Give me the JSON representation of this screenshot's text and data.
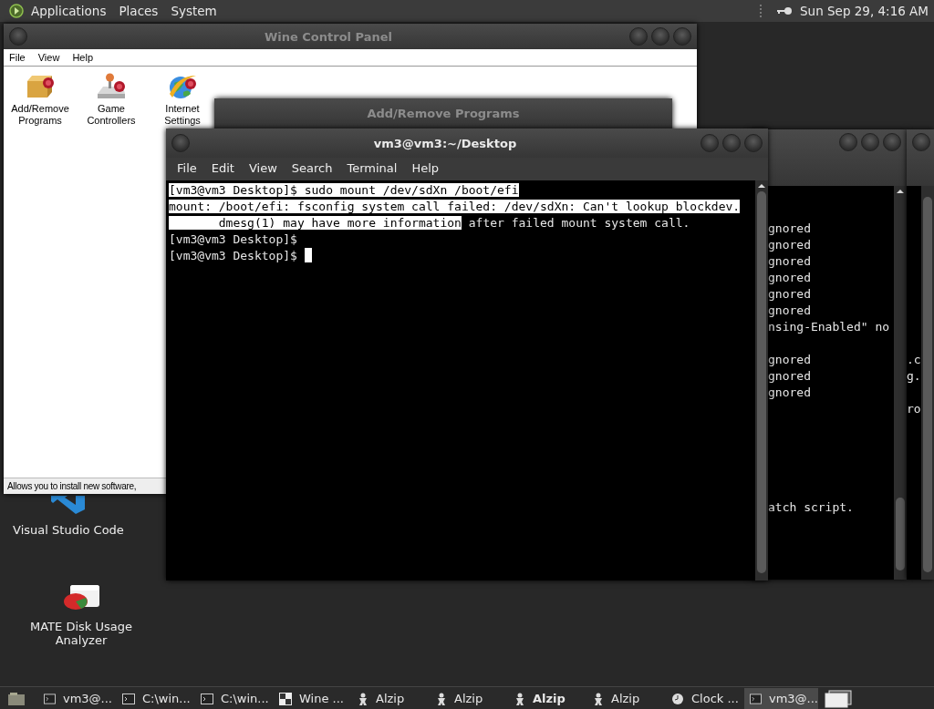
{
  "top_panel": {
    "menus": [
      "Applications",
      "Places",
      "System"
    ],
    "clock": "Sun Sep 29, 4:16 AM"
  },
  "desktop_icons": [
    {
      "label": "Visual Studio Code",
      "kind": "code"
    },
    {
      "label": "MATE Disk Usage Analyzer",
      "kind": "disk"
    }
  ],
  "wine_control_panel": {
    "title": "Wine Control Panel",
    "menu": [
      "File",
      "View",
      "Help"
    ],
    "applets": [
      {
        "label": "Add/Remove Programs",
        "kind": "box"
      },
      {
        "label": "Game Controllers",
        "kind": "joystick"
      },
      {
        "label": "Internet Settings",
        "kind": "globe"
      }
    ],
    "status_bar": "Allows you to install new software,"
  },
  "add_remove_dialog": {
    "title": "Add/Remove Programs"
  },
  "background_terminal": {
    "groups": [
      [
        "gnored",
        "gnored",
        "gnored",
        "gnored",
        "gnored",
        "gnored",
        "nsing-Enabled\" no"
      ],
      [
        "gnored",
        "gnored",
        "gnored"
      ],
      [
        "atch script."
      ]
    ]
  },
  "right_window": {
    "groups": [
      [
        ".c",
        "g."
      ],
      [
        "ro"
      ]
    ]
  },
  "terminal": {
    "title": "vm3@vm3:~/Desktop",
    "menu": [
      "File",
      "Edit",
      "View",
      "Search",
      "Terminal",
      "Help"
    ],
    "lines": [
      {
        "segments": [
          {
            "text": "[vm3@vm3 Desktop]$ sudo mount /dev/sdXn /boot/efi",
            "selected": true
          }
        ]
      },
      {
        "segments": [
          {
            "text": "mount: /boot/efi: fsconfig system call failed: /dev/sdXn: Can't lookup blockdev.",
            "selected": true
          }
        ]
      },
      {
        "segments": [
          {
            "text": "       dmesg(1) may have more information",
            "selected": true
          },
          {
            "text": " after failed mount system call.",
            "selected": false
          }
        ]
      },
      {
        "segments": [
          {
            "text": "[vm3@vm3 Desktop]$",
            "selected": false
          }
        ]
      },
      {
        "segments": [
          {
            "text": "[vm3@vm3 Desktop]$ ",
            "selected": false
          }
        ],
        "cursor": true
      }
    ]
  },
  "taskbar": {
    "items": [
      {
        "label": "vm3@...",
        "kind": "terminal",
        "selected": false,
        "bold": false
      },
      {
        "label": "C:\\win...",
        "kind": "terminal",
        "selected": false,
        "bold": false
      },
      {
        "label": "C:\\win...",
        "kind": "terminal",
        "selected": false,
        "bold": false
      },
      {
        "label": "Wine ...",
        "kind": "wine",
        "selected": false,
        "bold": false
      },
      {
        "label": "Alzip",
        "kind": "alzip",
        "selected": false,
        "bold": false
      },
      {
        "label": "Alzip",
        "kind": "alzip",
        "selected": false,
        "bold": false
      },
      {
        "label": "Alzip",
        "kind": "alzip",
        "selected": false,
        "bold": true
      },
      {
        "label": "Alzip",
        "kind": "alzip",
        "selected": false,
        "bold": false
      },
      {
        "label": "Clock ...",
        "kind": "clock",
        "selected": false,
        "bold": false
      },
      {
        "label": "vm3@...",
        "kind": "terminal",
        "selected": true,
        "bold": false
      }
    ]
  }
}
